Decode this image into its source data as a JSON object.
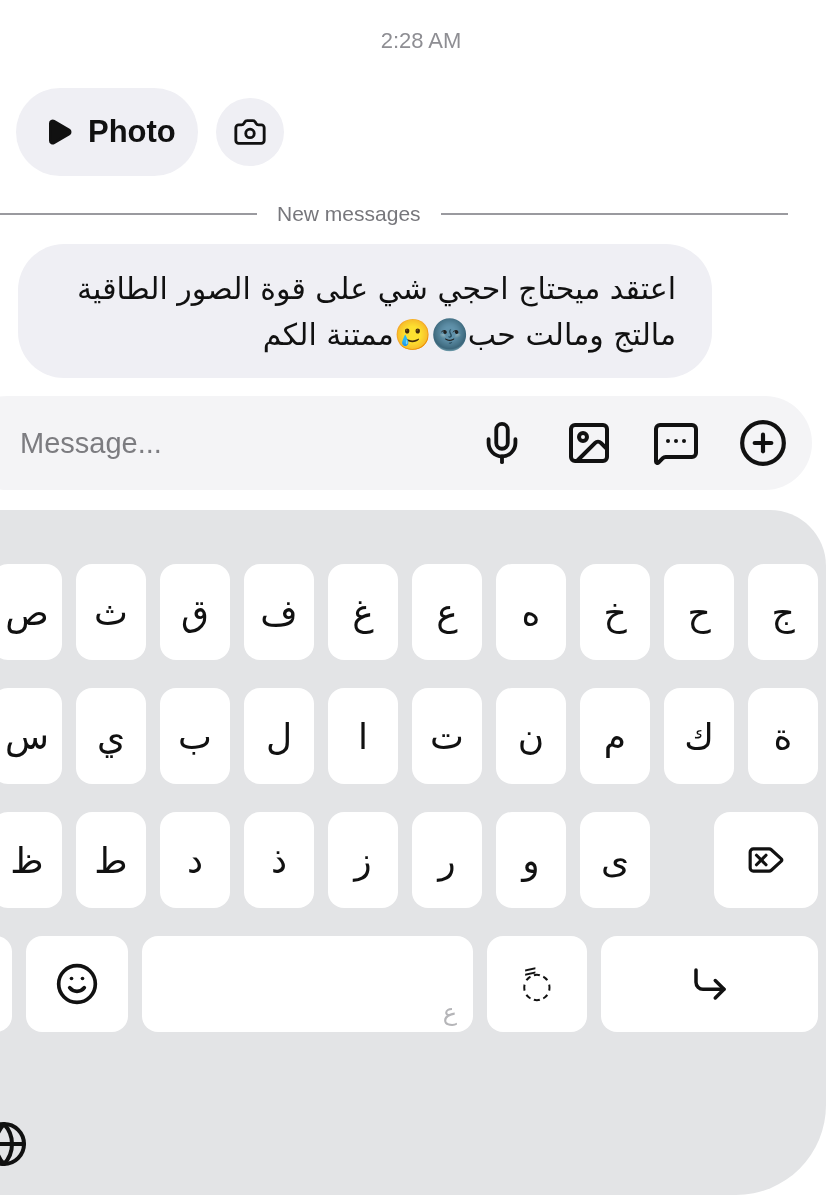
{
  "timestamp": "2:28 AM",
  "photo_message": {
    "label": "Photo"
  },
  "divider": {
    "label": "New messages"
  },
  "received_message": {
    "text": "اعتقد ميحتاج احجي شي على قوة الصور الطاقية مالتج ومالت حب🌚🥲ممتنة الكم"
  },
  "composer": {
    "placeholder": "Message..."
  },
  "keyboard": {
    "rows": [
      [
        {
          "kind": "letter",
          "label": "ج"
        },
        {
          "kind": "letter",
          "label": "ح"
        },
        {
          "kind": "letter",
          "label": "خ"
        },
        {
          "kind": "letter",
          "label": "ه"
        },
        {
          "kind": "letter",
          "label": "ع"
        },
        {
          "kind": "letter",
          "label": "غ"
        },
        {
          "kind": "letter",
          "label": "ف"
        },
        {
          "kind": "letter",
          "label": "ق"
        },
        {
          "kind": "letter",
          "label": "ث"
        },
        {
          "kind": "letter",
          "label": "ص"
        }
      ],
      [
        {
          "kind": "letter",
          "label": "ة"
        },
        {
          "kind": "letter",
          "label": "ك"
        },
        {
          "kind": "letter",
          "label": "م"
        },
        {
          "kind": "letter",
          "label": "ن"
        },
        {
          "kind": "letter",
          "label": "ت"
        },
        {
          "kind": "letter",
          "label": "ا"
        },
        {
          "kind": "letter",
          "label": "ل"
        },
        {
          "kind": "letter",
          "label": "ب"
        },
        {
          "kind": "letter",
          "label": "ي"
        },
        {
          "kind": "letter",
          "label": "س"
        }
      ],
      [
        {
          "kind": "delete"
        },
        "",
        {
          "kind": "letter",
          "label": "ى"
        },
        {
          "kind": "letter",
          "label": "و"
        },
        {
          "kind": "letter",
          "label": "ر"
        },
        {
          "kind": "letter",
          "label": "ز"
        },
        {
          "kind": "letter",
          "label": "ذ"
        },
        {
          "kind": "letter",
          "label": "د"
        },
        {
          "kind": "letter",
          "label": "ط"
        },
        {
          "kind": "letter",
          "label": "ظ"
        }
      ]
    ],
    "bottom_row": [
      {
        "kind": "return"
      },
      {
        "kind": "diacritic",
        "label": "◌ً"
      },
      {
        "kind": "space",
        "label": "ع"
      },
      {
        "kind": "emoji"
      },
      {
        "kind": "blank"
      }
    ]
  }
}
